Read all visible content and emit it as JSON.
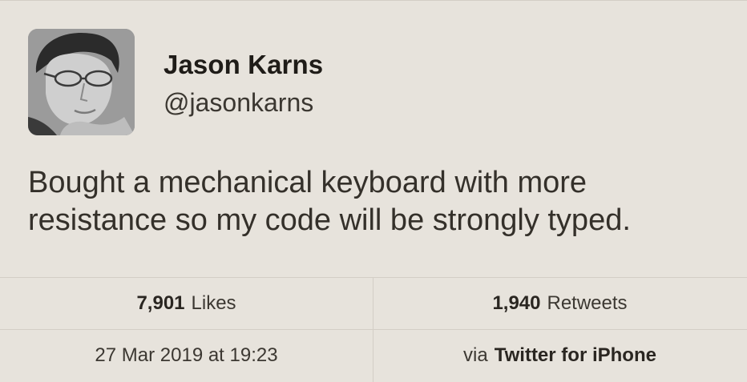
{
  "user": {
    "display_name": "Jason Karns",
    "handle": "@jasonkarns",
    "avatar": "profile-photo"
  },
  "tweet": {
    "lines": [
      "Bought a mechanical keyboard with more",
      "resistance so my code will be strongly typed."
    ]
  },
  "stats": {
    "likes_count": "7,901",
    "likes_label": "Likes",
    "retweets_count": "1,940",
    "retweets_label": "Retweets"
  },
  "meta": {
    "timestamp": "27 Mar 2019 at 19:23",
    "via_label": "via",
    "source": "Twitter for iPhone"
  },
  "colors": {
    "background": "#e7e3dc",
    "divider": "#d3cec6",
    "text": "#2f2b26"
  }
}
